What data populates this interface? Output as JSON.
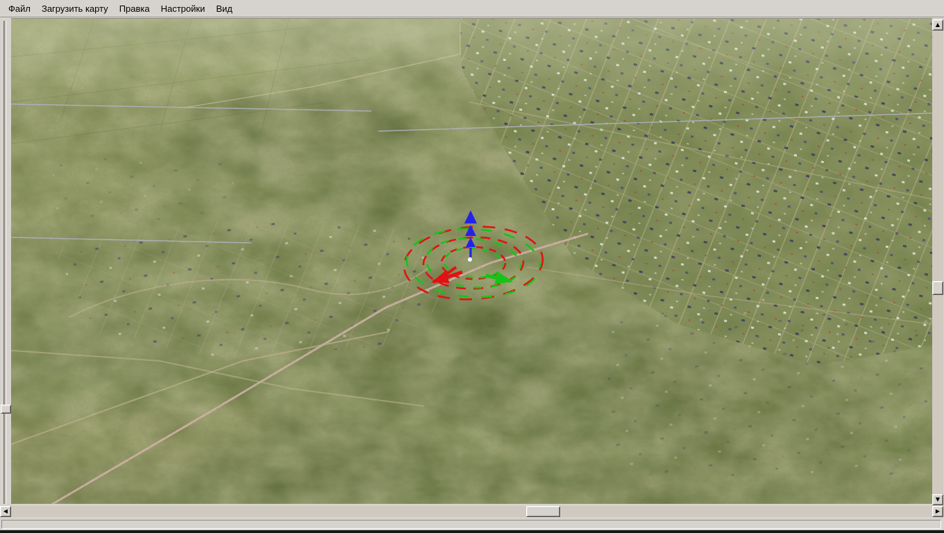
{
  "app": {
    "menu": {
      "items": [
        {
          "id": "file",
          "label": "Файл"
        },
        {
          "id": "load-map",
          "label": "Загрузить карту"
        },
        {
          "id": "edit",
          "label": "Правка"
        },
        {
          "id": "settings",
          "label": "Настройки"
        },
        {
          "id": "view",
          "label": "Вид"
        }
      ]
    },
    "status_bar": {
      "text": ""
    }
  },
  "icons": {
    "scroll_up": "▲",
    "scroll_down": "▼",
    "scroll_left": "◀",
    "scroll_right": "▶"
  },
  "map": {
    "view": "aerial-perspective-terrain",
    "center_marker": "transform-gizmo"
  },
  "colors": {
    "window_chrome": "#d6d3ce",
    "gizmo_axis_blue": "#2323e8",
    "gizmo_ring_red": "#e01212",
    "gizmo_ring_green": "#16c416",
    "power_line": "#b4b4c4",
    "main_road_pink": "#d2b3a8"
  }
}
